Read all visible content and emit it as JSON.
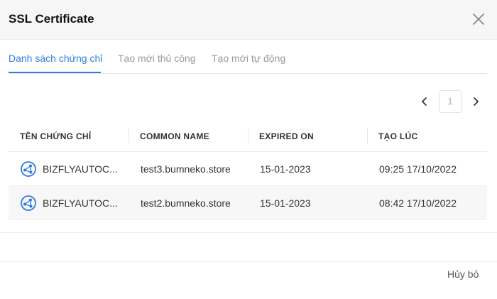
{
  "dialog": {
    "title": "SSL Certificate"
  },
  "tabs": [
    {
      "label": "Danh sách chứng chỉ",
      "active": true
    },
    {
      "label": "Tạo mới thủ công",
      "active": false
    },
    {
      "label": "Tạo mới tự động",
      "active": false
    }
  ],
  "pagination": {
    "current_page": "1"
  },
  "table": {
    "columns": [
      "TÊN CHỨNG CHỈ",
      "COMMON NAME",
      "EXPIRED ON",
      "TẠO LÚC"
    ],
    "rows": [
      {
        "name": "BIZFLYAUTOC...",
        "common_name": "test3.bumneko.store",
        "expired_on": "15-01-2023",
        "created_at": "09:25 17/10/2022"
      },
      {
        "name": "BIZFLYAUTOC...",
        "common_name": "test2.bumneko.store",
        "expired_on": "15-01-2023",
        "created_at": "08:42 17/10/2022"
      }
    ]
  },
  "footer": {
    "cancel_label": "Hủy bỏ"
  },
  "colors": {
    "accent": "#2f7de1",
    "header_bg": "#f6f6f6",
    "row_alt_bg": "#f7f7f7"
  },
  "icons": {
    "close": "close-icon",
    "prev": "chevron-left-icon",
    "next": "chevron-right-icon",
    "certificate": "network-share-icon"
  }
}
